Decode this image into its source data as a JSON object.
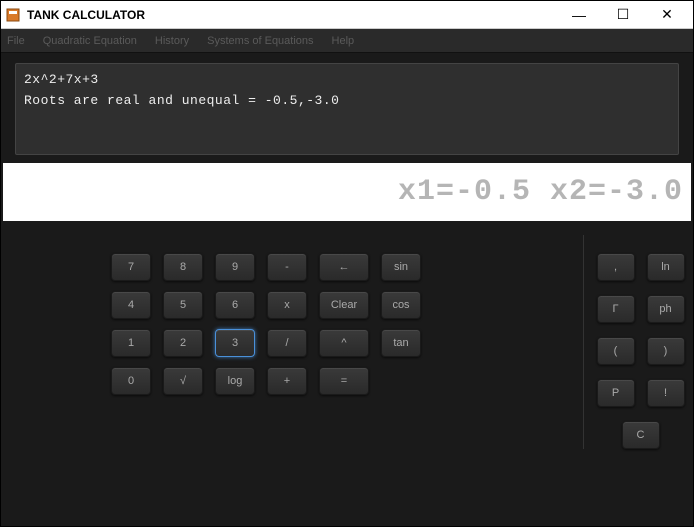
{
  "window": {
    "title": "TANK CALCULATOR",
    "minimize": "—",
    "maximize": "☐",
    "close": "✕"
  },
  "menu": {
    "file": "File",
    "quadratic": "Quadratic Equation",
    "history": "History",
    "systems": "Systems of Equations",
    "help": "Help"
  },
  "history": {
    "line1": "2x^2+7x+3",
    "line2": "Roots are real and unequal  =  -0.5,-3.0"
  },
  "display": {
    "value": "x1=-0.5 x2=-3.0"
  },
  "keys": {
    "row1": {
      "k1": "7",
      "k2": "8",
      "k3": "9",
      "k4": "-",
      "k5": "←",
      "k6": "sin"
    },
    "row2": {
      "k1": "4",
      "k2": "5",
      "k3": "6",
      "k4": "x",
      "k5": "Clear",
      "k6": "cos"
    },
    "row3": {
      "k1": "1",
      "k2": "2",
      "k3": "3",
      "k4": "/",
      "k5": "^",
      "k6": "tan"
    },
    "row4": {
      "k1": "0",
      "k2": "√",
      "k3": "log",
      "k4": "+",
      "k5": "="
    }
  },
  "side": {
    "comma": ",",
    "ln": "ln",
    "gamma": "Γ",
    "ph": "ph",
    "lparen": "(",
    "rparen": ")",
    "p": "P",
    "excl": "!",
    "c": "C"
  }
}
